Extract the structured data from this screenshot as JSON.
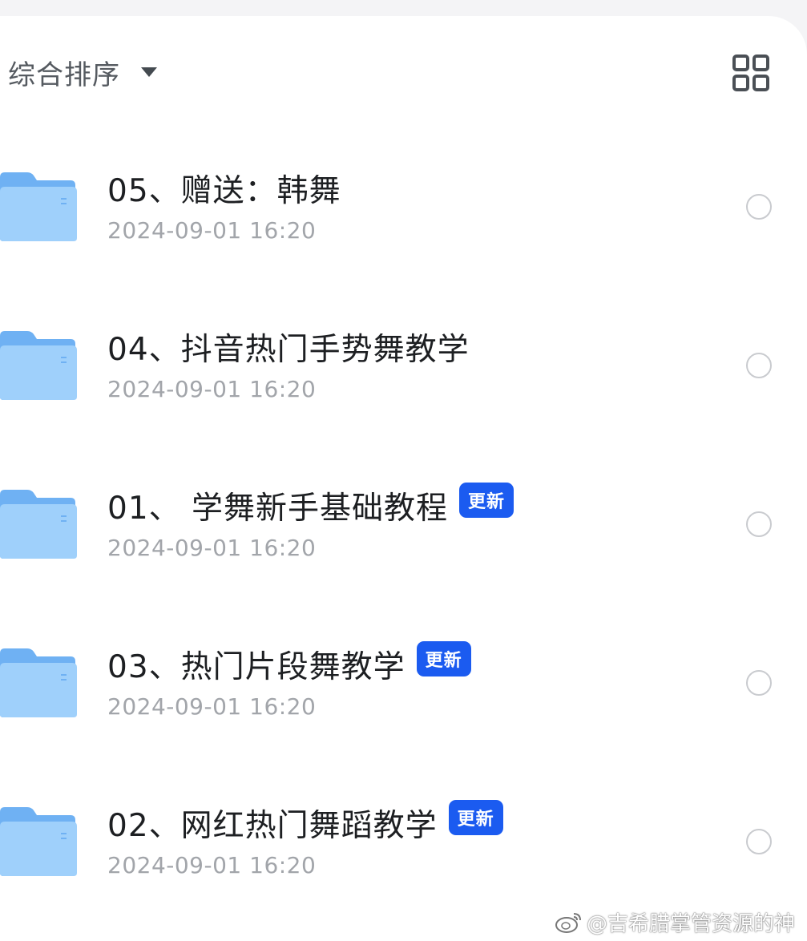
{
  "toolbar": {
    "sort_label": "综合排序",
    "sort_icon": "caret-down-icon",
    "view_toggle_icon": "grid-view-icon"
  },
  "files": [
    {
      "name": "05、赠送：韩舞",
      "date": "2024-09-01 16:20",
      "badge": ""
    },
    {
      "name": "04、抖音热门手势舞教学",
      "date": "2024-09-01 16:20",
      "badge": ""
    },
    {
      "name": "01、 学舞新手基础教程",
      "date": "2024-09-01 16:20",
      "badge": "更新"
    },
    {
      "name": "03、热门片段舞教学",
      "date": "2024-09-01 16:20",
      "badge": "更新"
    },
    {
      "name": "02、网红热门舞蹈教学",
      "date": "2024-09-01 16:20",
      "badge": "更新"
    }
  ],
  "watermark": {
    "text": "@吉希腊掌管资源的神",
    "icon": "weibo-logo"
  },
  "colors": {
    "badge": "#1b5bf0",
    "folder": "#8cc4f8",
    "title_text": "#1d1f22",
    "date_text": "#a2a5aa"
  }
}
